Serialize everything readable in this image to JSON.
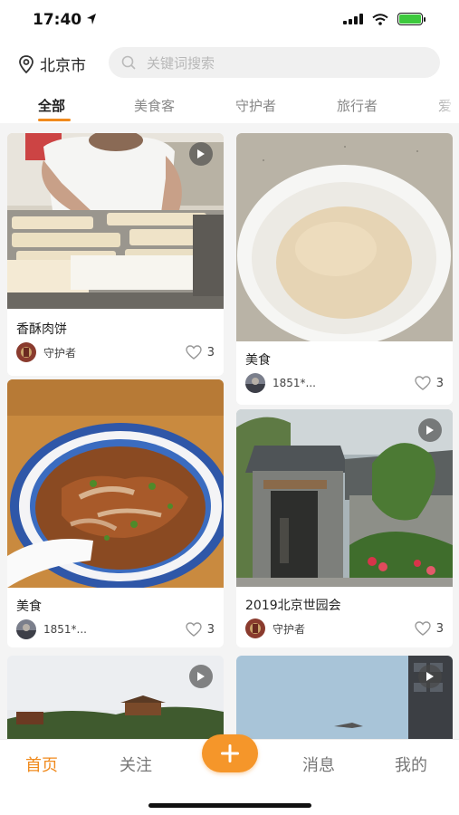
{
  "status": {
    "time": "17:40"
  },
  "header": {
    "location": "北京市",
    "search_placeholder": "关键词搜索"
  },
  "tabs": [
    "全部",
    "美食客",
    "守护者",
    "旅行者",
    "爱"
  ],
  "cards": [
    {
      "title": "香酥肉饼",
      "author": "守护者",
      "likes": "3",
      "has_play_icon": true
    },
    {
      "title": "美食",
      "author": "1851*...",
      "likes": "3",
      "has_play_icon": false
    },
    {
      "title": "美食",
      "author": "1851*...",
      "likes": "3",
      "has_play_icon": false
    },
    {
      "title": "2019北京世园会",
      "author": "守护者",
      "likes": "3",
      "has_play_icon": true
    },
    {
      "title": "",
      "author": "",
      "likes": "",
      "has_play_icon": true
    },
    {
      "title": "",
      "author": "",
      "likes": "",
      "has_play_icon": true
    }
  ],
  "bottom_nav": {
    "home": "首页",
    "follow": "关注",
    "add": "+",
    "messages": "消息",
    "mine": "我的"
  },
  "colors": {
    "accent": "#f08a1d",
    "battery": "#3dc93d"
  },
  "icons": [
    "location-arrow-icon",
    "signal-icon",
    "wifi-icon",
    "battery-icon",
    "location-pin-icon",
    "search-icon",
    "play-icon",
    "heart-icon",
    "plus-icon"
  ]
}
